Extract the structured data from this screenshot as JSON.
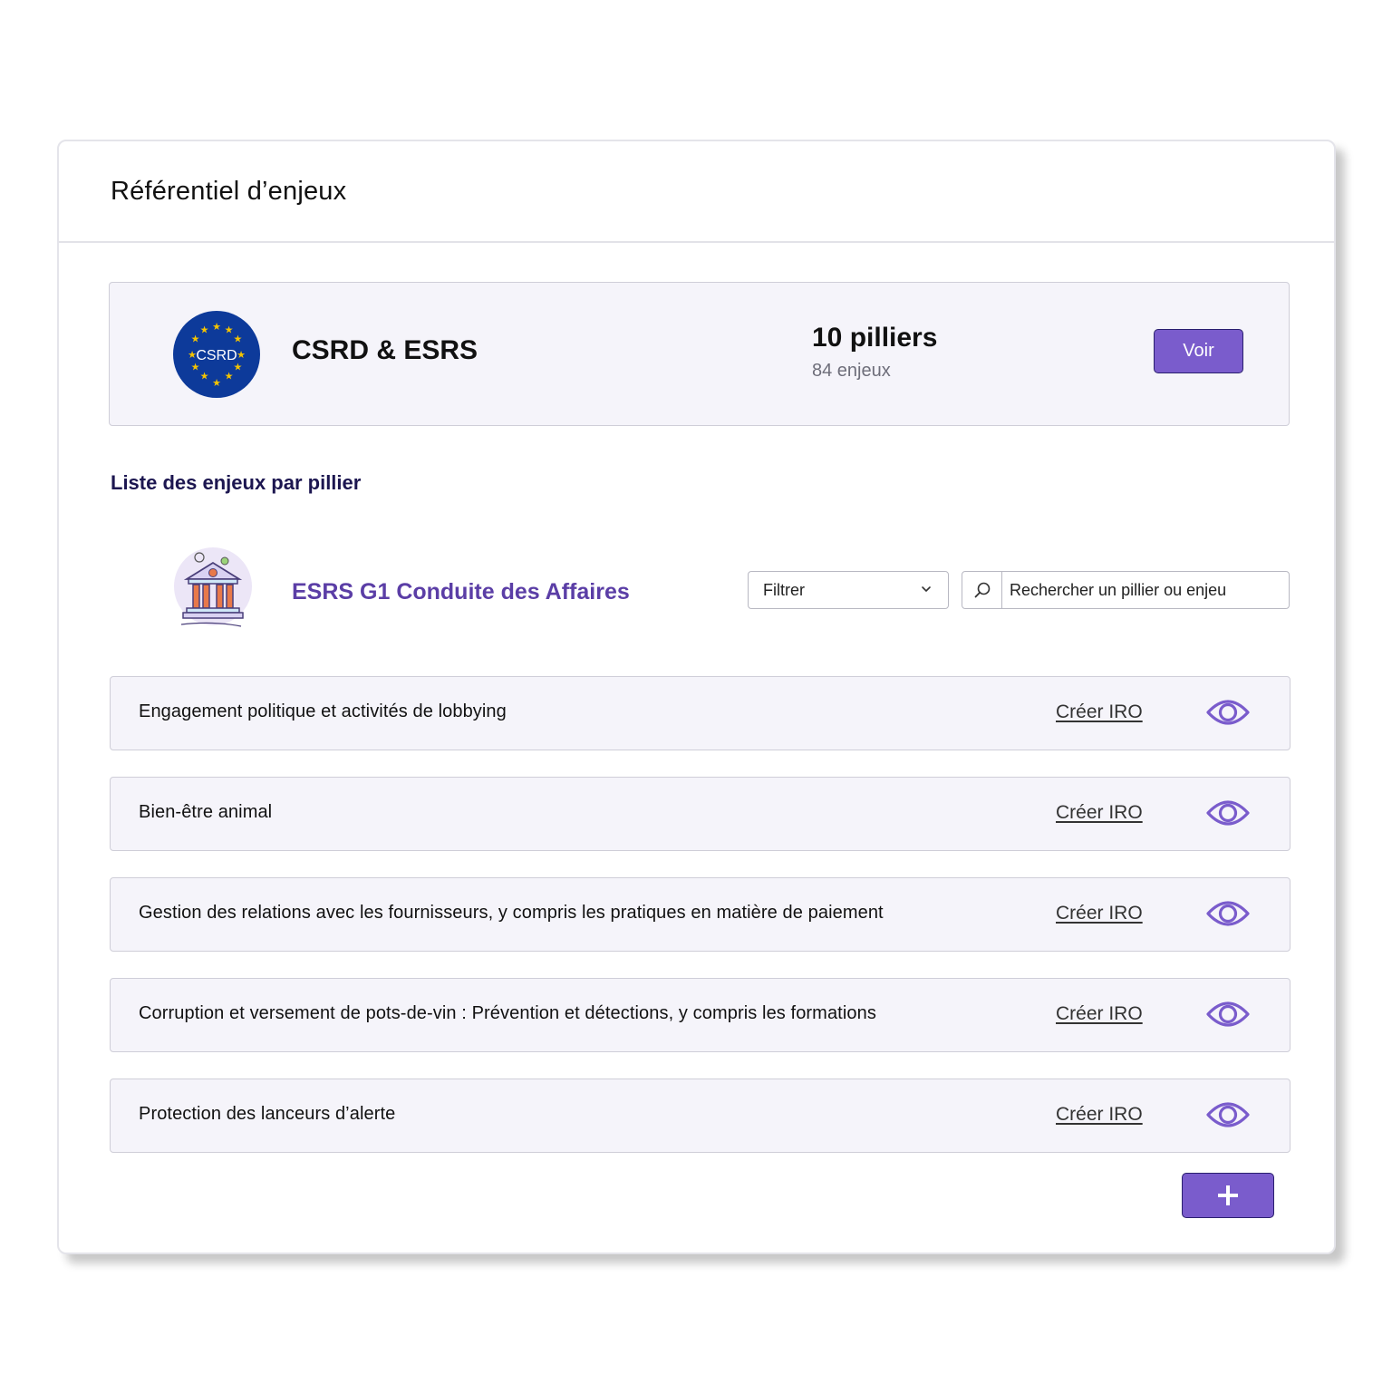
{
  "panel": {
    "title": "Référentiel d’enjeux"
  },
  "framework": {
    "logo_text": "CSRD",
    "name": "CSRD & ESRS",
    "pillars": "10 pilliers",
    "issues": "84 enjeux",
    "view_label": "Voir"
  },
  "section": {
    "title": "Liste des enjeux par pillier"
  },
  "pillar": {
    "name": "ESRS G1 Conduite des Affaires",
    "icon": "bank-building-icon"
  },
  "filter": {
    "label": "Filtrer"
  },
  "search": {
    "placeholder": "Rechercher un pillier ou enjeu"
  },
  "issues": [
    {
      "label": "Engagement politique et activités de lobbying",
      "action": "Créer IRO"
    },
    {
      "label": "Bien-être animal",
      "action": "Créer IRO"
    },
    {
      "label": "Gestion des relations avec les fournisseurs, y compris les pratiques en matière de paiement",
      "action": "Créer IRO"
    },
    {
      "label": "Corruption et versement de pots-de-vin : Prévention et détections, y compris les formations",
      "action": "Créer IRO"
    },
    {
      "label": "Protection des lanceurs d’alerte",
      "action": "Créer IRO"
    }
  ],
  "add_button": {
    "icon": "plus-icon"
  },
  "colors": {
    "accent": "#7a5ccc",
    "accent_border": "#2a1f6e",
    "pillar_title": "#5b3ea6",
    "eu_blue": "#0d3a9a",
    "eu_star": "#f5c400",
    "card_bg": "#f5f4fa"
  }
}
